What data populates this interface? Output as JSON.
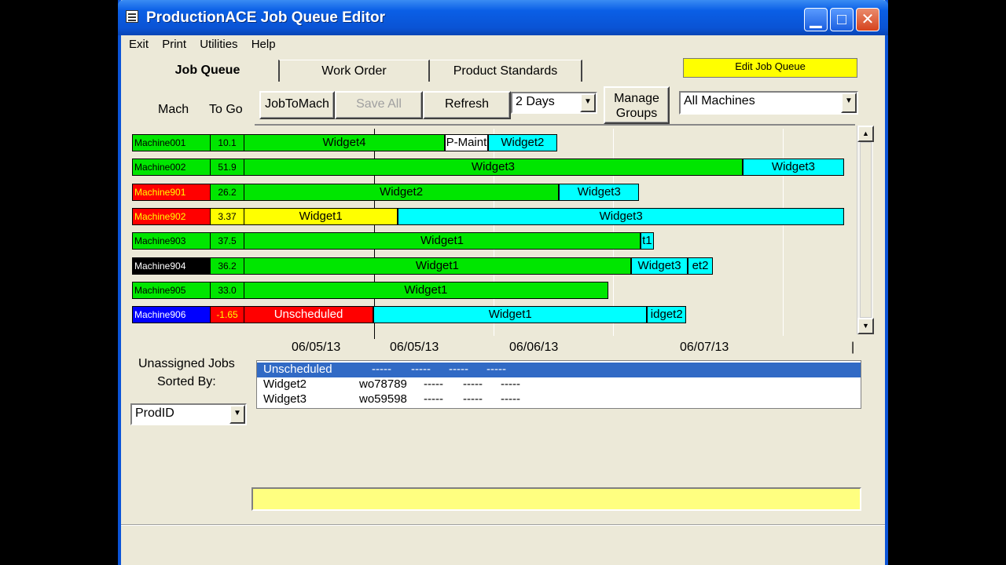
{
  "window": {
    "title": "ProductionACE Job Queue Editor",
    "controls": {
      "minimize": "▁",
      "maximize": "□",
      "close": "✕"
    }
  },
  "menu": [
    "Exit",
    "Print",
    "Utilities",
    "Help"
  ],
  "tabs": {
    "job_queue": "Job Queue",
    "work_order": "Work Order",
    "product_standards": "Product Standards"
  },
  "edit_button": "Edit Job Queue",
  "toolbar": {
    "mach_label": "Mach",
    "togo_label": "To Go",
    "job_to_mach": "JobToMach",
    "save_all": "Save All",
    "refresh": "Refresh",
    "days_value": "2 Days",
    "manage_groups_line1": "Manage",
    "manage_groups_line2": "Groups",
    "machines_value": "All Machines"
  },
  "colors": {
    "green": "#00e600",
    "cyan": "#00ffff",
    "red": "#ff0000",
    "yellow": "#ffff00",
    "white": "#ffffff",
    "black": "#000000",
    "blue": "#0000ff",
    "selection": "#316ac5"
  },
  "machines": [
    {
      "name": "Machine001",
      "togo": "10.1",
      "name_bg": "green",
      "name_fg": "black",
      "togo_bg": "green",
      "togo_fg": "black",
      "bars": [
        {
          "label": "Widget4",
          "color": "green",
          "start": 0.0,
          "end": 0.335
        },
        {
          "label": "P-Maint",
          "color": "white",
          "start": 0.335,
          "end": 0.407
        },
        {
          "label": "Widget2",
          "color": "cyan",
          "start": 0.407,
          "end": 0.522
        }
      ]
    },
    {
      "name": "Machine002",
      "togo": "51.9",
      "name_bg": "green",
      "name_fg": "black",
      "togo_bg": "green",
      "togo_fg": "black",
      "bars": [
        {
          "label": "Widget3",
          "color": "green",
          "start": 0.0,
          "end": 0.831
        },
        {
          "label": "Widget3",
          "color": "cyan",
          "start": 0.831,
          "end": 1.0
        }
      ]
    },
    {
      "name": "Machine901",
      "togo": "26.2",
      "name_bg": "red",
      "name_fg": "yellow",
      "togo_bg": "green",
      "togo_fg": "black",
      "bars": [
        {
          "label": "Widget2",
          "color": "green",
          "start": 0.0,
          "end": 0.525
        },
        {
          "label": "Widget3",
          "color": "cyan",
          "start": 0.525,
          "end": 0.659
        }
      ]
    },
    {
      "name": "Machine902",
      "togo": "3.37",
      "name_bg": "red",
      "name_fg": "yellow",
      "togo_bg": "yellow",
      "togo_fg": "black",
      "bars": [
        {
          "label": "Widget1",
          "color": "yellow",
          "start": 0.0,
          "end": 0.257
        },
        {
          "label": "Widget3",
          "color": "cyan",
          "start": 0.257,
          "end": 1.0
        }
      ]
    },
    {
      "name": "Machine903",
      "togo": "37.5",
      "name_bg": "green",
      "name_fg": "black",
      "togo_bg": "green",
      "togo_fg": "black",
      "bars": [
        {
          "label": "Widget1",
          "color": "green",
          "start": 0.0,
          "end": 0.661
        },
        {
          "label": "t1",
          "color": "cyan",
          "start": 0.661,
          "end": 0.683
        }
      ]
    },
    {
      "name": "Machine904",
      "togo": "36.2",
      "name_bg": "black",
      "name_fg": "white",
      "togo_bg": "green",
      "togo_fg": "black",
      "bars": [
        {
          "label": "Widget1",
          "color": "green",
          "start": 0.0,
          "end": 0.645
        },
        {
          "label": "Widget3",
          "color": "cyan",
          "start": 0.645,
          "end": 0.74
        },
        {
          "label": "et2",
          "color": "cyan",
          "start": 0.74,
          "end": 0.781
        }
      ]
    },
    {
      "name": "Machine905",
      "togo": "33.0",
      "name_bg": "green",
      "name_fg": "black",
      "togo_bg": "green",
      "togo_fg": "black",
      "bars": [
        {
          "label": "Widget1",
          "color": "green",
          "start": 0.0,
          "end": 0.607
        }
      ]
    },
    {
      "name": "Machine906",
      "togo": "-1.65",
      "name_bg": "blue",
      "name_fg": "white",
      "togo_bg": "red",
      "togo_fg": "yellow",
      "bars": [
        {
          "label": "Unscheduled",
          "color": "red",
          "start": 0.0,
          "end": 0.216
        },
        {
          "label": "Widget1",
          "color": "cyan",
          "start": 0.216,
          "end": 0.672
        },
        {
          "label": "idget2",
          "color": "cyan",
          "start": 0.672,
          "end": 0.737
        }
      ]
    }
  ],
  "x_axis": {
    "ticks": [
      "06/05/13",
      "06/05/13",
      "06/06/13",
      "06/07/13",
      "|"
    ]
  },
  "unassigned": {
    "title_line1": "Unassigned Jobs",
    "title_line2": "Sorted By:",
    "sort_value": "ProdID",
    "rows": [
      {
        "c1": "Unscheduled",
        "c2": "-----",
        "c3": "-----",
        "c4": "-----",
        "c5": "-----",
        "selected": true
      },
      {
        "c1": "Widget2",
        "c2": "wo78789",
        "c3": "-----",
        "c4": "-----",
        "c5": "-----",
        "selected": false
      },
      {
        "c1": "Widget3",
        "c2": "wo59598",
        "c3": "-----",
        "c4": "-----",
        "c5": "-----",
        "selected": false
      }
    ]
  },
  "status_text": ""
}
